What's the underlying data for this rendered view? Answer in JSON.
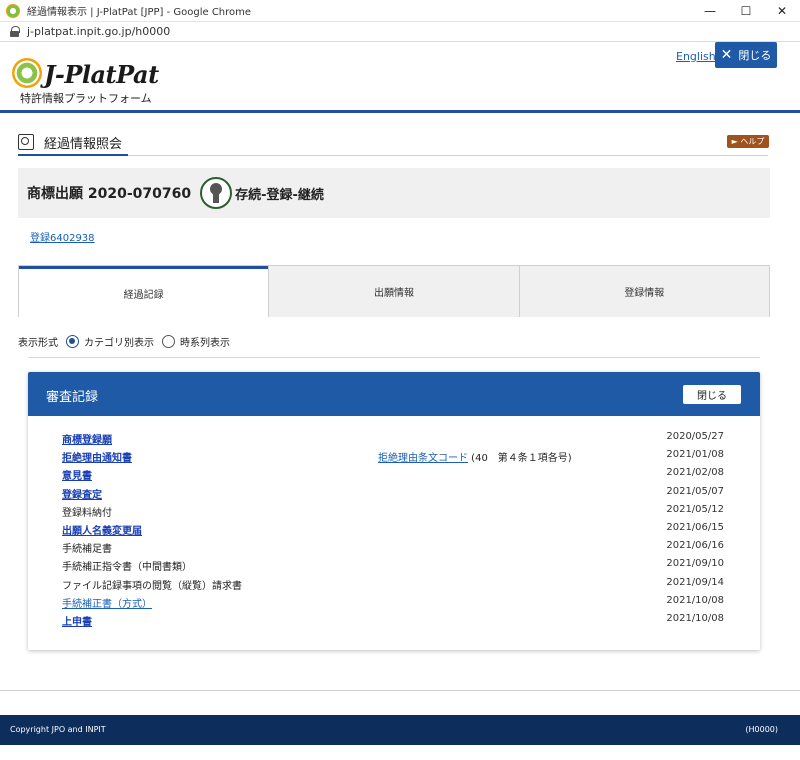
{
  "window": {
    "title": "経過情報表示 | J-PlatPat [JPP] - Google Chrome",
    "url": "j-platpat.inpit.go.jp/h0000",
    "controls": {
      "minimize": "—",
      "maximize": "☐",
      "close": "✕"
    }
  },
  "header": {
    "logo": "J-PlatPat",
    "subtitle": "特許情報プラットフォーム",
    "language_link": "English",
    "close_label": "閉じる",
    "close_icon": "✕"
  },
  "page": {
    "title": "経過情報照会",
    "help_label": "► ヘルプ"
  },
  "summary": {
    "title": "商標出願 2020-070760",
    "status": "存続-登録-継続",
    "registration_link": "登録6402938"
  },
  "tabs": [
    {
      "label": "経過記録",
      "active": true
    },
    {
      "label": "出願情報",
      "active": false
    },
    {
      "label": "登録情報",
      "active": false
    }
  ],
  "display_format": {
    "label": "表示形式",
    "options": [
      {
        "label": "カテゴリ別表示",
        "selected": true
      },
      {
        "label": "時系列表示",
        "selected": false
      }
    ]
  },
  "record": {
    "title": "審査記録",
    "close_label": "閉じる",
    "rows": [
      {
        "name": "商標登録願",
        "link": true,
        "date": "2020/05/27"
      },
      {
        "name": "拒絶理由通知書",
        "link": true,
        "extra_link": "拒絶理由条文コード",
        "extra_text": " (40　第４条１項各号)",
        "date": "2021/01/08"
      },
      {
        "name": "意見書",
        "link": true,
        "date": "2021/02/08"
      },
      {
        "name": "登録査定",
        "link": true,
        "date": "2021/05/07"
      },
      {
        "name": "登録料納付",
        "link": false,
        "date": "2021/05/12"
      },
      {
        "name": "出願人名義変更届",
        "link": true,
        "date": "2021/06/15"
      },
      {
        "name": "手続補足書",
        "link": false,
        "date": "2021/06/16"
      },
      {
        "name": "手続補正指令書（中間書類）",
        "link": false,
        "date": "2021/09/10"
      },
      {
        "name": "ファイル記録事項の閲覧（縦覧）請求書",
        "link": false,
        "date": "2021/09/14"
      },
      {
        "name": "手続補正書（方式）",
        "link": "plain",
        "date": "2021/10/08"
      },
      {
        "name": "上申書",
        "link": true,
        "date": "2021/10/08"
      }
    ]
  },
  "footer": {
    "copyright": "Copyright JPO and INPIT",
    "code": "(H0000)"
  }
}
